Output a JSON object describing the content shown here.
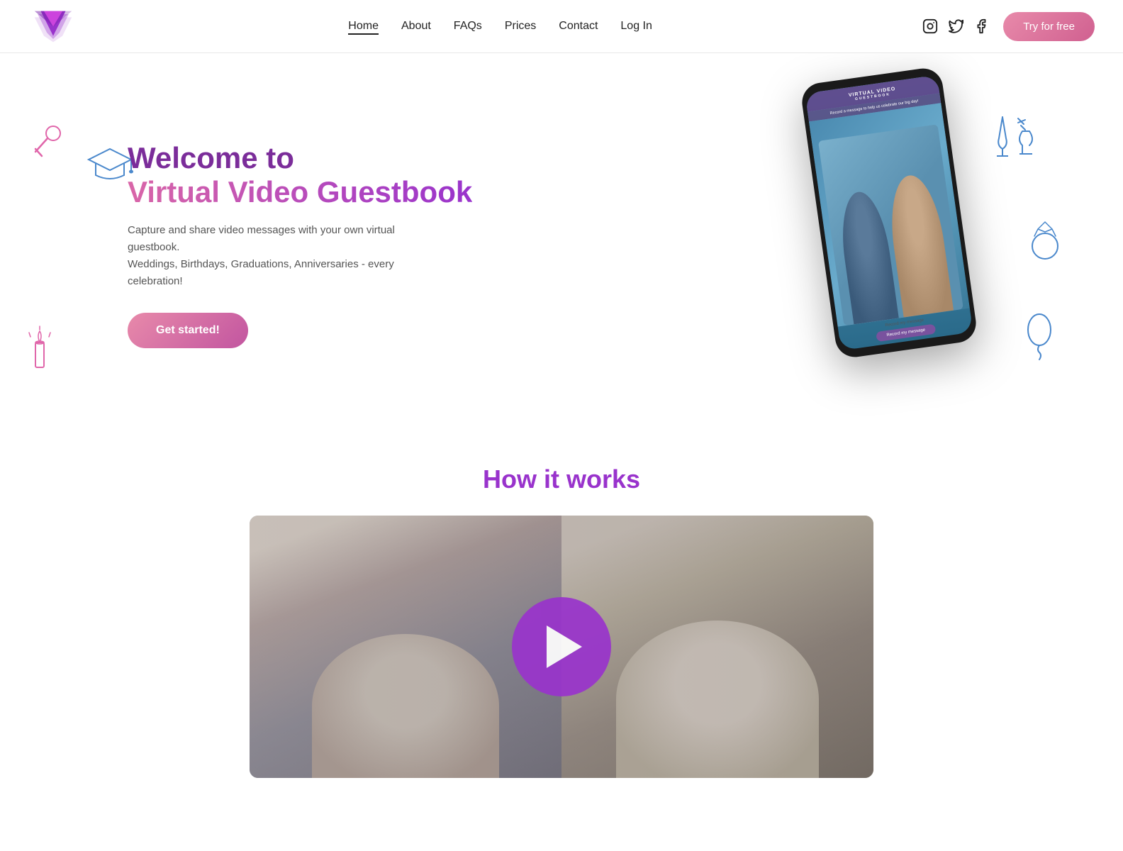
{
  "nav": {
    "logo_alt": "Virtual Video Guestbook Logo",
    "links": [
      {
        "label": "Home",
        "active": true
      },
      {
        "label": "About",
        "active": false
      },
      {
        "label": "FAQs",
        "active": false
      },
      {
        "label": "Prices",
        "active": false
      },
      {
        "label": "Contact",
        "active": false
      },
      {
        "label": "Log In",
        "active": false
      }
    ],
    "social": [
      "instagram",
      "twitter",
      "facebook"
    ],
    "cta_label": "Try for free"
  },
  "hero": {
    "title_line1": "Welcome to",
    "title_line2": "Virtual Video Guestbook",
    "subtitle_line1": "Capture and share video messages with your own virtual guestbook.",
    "subtitle_line2": "Weddings, Birthdays, Graduations, Anniversaries - every celebration!",
    "cta_label": "Get started!",
    "phone_header": "VIRTUAL VIDEO",
    "phone_header_sub": "GUESTBOOK",
    "phone_caption": "Record a message to help us celebrate our big day!",
    "phone_record_label": "Record my message"
  },
  "how_it_works": {
    "title": "How it works"
  }
}
